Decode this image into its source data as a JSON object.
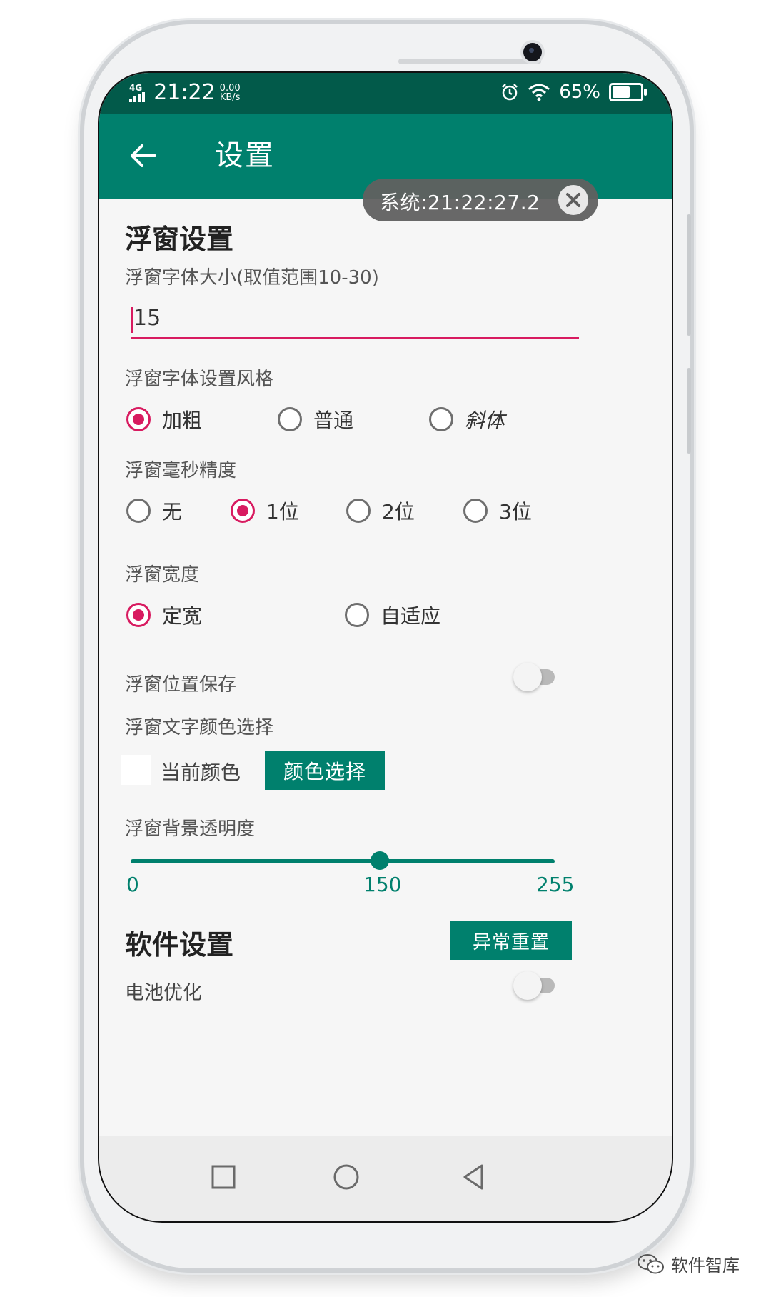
{
  "status": {
    "network": "4G",
    "time": "21:22",
    "speed_value": "0.00",
    "speed_unit": "KB/s",
    "battery": "65%"
  },
  "appbar": {
    "title": "设置"
  },
  "floating": {
    "text": "系统:21:22:27.2"
  },
  "float_settings": {
    "title": "浮窗设置",
    "font_size_label": "浮窗字体大小(取值范围10-30)",
    "font_size_value": "15",
    "style_label": "浮窗字体设置风格",
    "style_options": [
      "加粗",
      "普通",
      "斜体"
    ],
    "ms_label": "浮窗毫秒精度",
    "ms_options": [
      "无",
      "1位",
      "2位",
      "3位"
    ],
    "width_label": "浮窗宽度",
    "width_options": [
      "定宽",
      "自适应"
    ],
    "pos_save_label": "浮窗位置保存",
    "color_label": "浮窗文字颜色选择",
    "current_color_label": "当前颜色",
    "color_button": "颜色选择",
    "alpha_label": "浮窗背景透明度",
    "alpha_min": "0",
    "alpha_value": "150",
    "alpha_max": "255"
  },
  "software_settings": {
    "title": "软件设置",
    "reset_button": "异常重置",
    "battery_opt_label": "电池优化"
  },
  "watermark": {
    "text": "软件智库"
  }
}
